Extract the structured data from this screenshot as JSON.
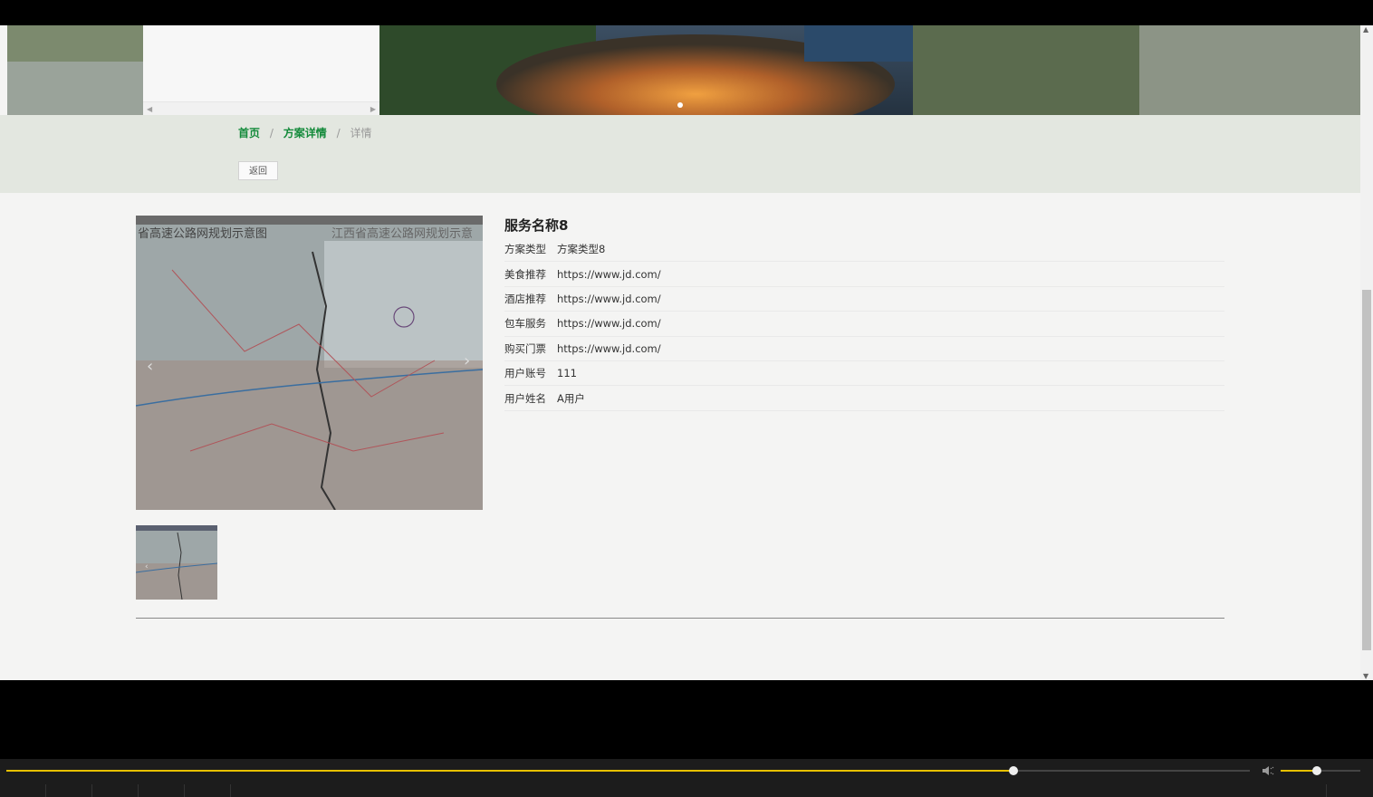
{
  "breadcrumb": {
    "home": "首页",
    "section": "方案详情",
    "current": "详情",
    "separator": "/"
  },
  "back_label": "返回",
  "detail": {
    "title": "服务名称8",
    "rows": [
      {
        "label": "方案类型",
        "value": "方案类型8"
      },
      {
        "label": "美食推荐",
        "value": "https://www.jd.com/"
      },
      {
        "label": "酒店推荐",
        "value": "https://www.jd.com/"
      },
      {
        "label": "包车服务",
        "value": "https://www.jd.com/"
      },
      {
        "label": "购买门票",
        "value": "https://www.jd.com/"
      },
      {
        "label": "用户账号",
        "value": "111"
      },
      {
        "label": "用户姓名",
        "value": "A用户"
      }
    ]
  },
  "map_image": {
    "caption_left": "省高速公路网规划示意图",
    "caption_right": "江西省高速公路网规划示意"
  },
  "player": {
    "progress": 0.81,
    "volume": 0.45
  },
  "colors": {
    "accent_green": "#138a3a",
    "crumb_band": "#e3e7e0",
    "player_accent": "#e6c000"
  }
}
